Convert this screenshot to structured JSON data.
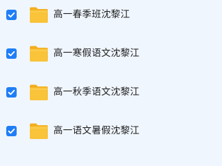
{
  "files": [
    {
      "name": "高一春季班沈黎江",
      "checked": true,
      "icon": "folder-icon"
    },
    {
      "name": "高一寒假语文沈黎江",
      "checked": true,
      "icon": "folder-icon"
    },
    {
      "name": "高一秋季语文沈黎江",
      "checked": true,
      "icon": "folder-icon"
    },
    {
      "name": "高一语文暑假沈黎江",
      "checked": true,
      "icon": "folder-icon"
    }
  ],
  "colors": {
    "background": "#f0f6fe",
    "checkbox": "#1f7ef6",
    "folder": "#f9c33a",
    "folder_tab": "#f3ad1c"
  }
}
